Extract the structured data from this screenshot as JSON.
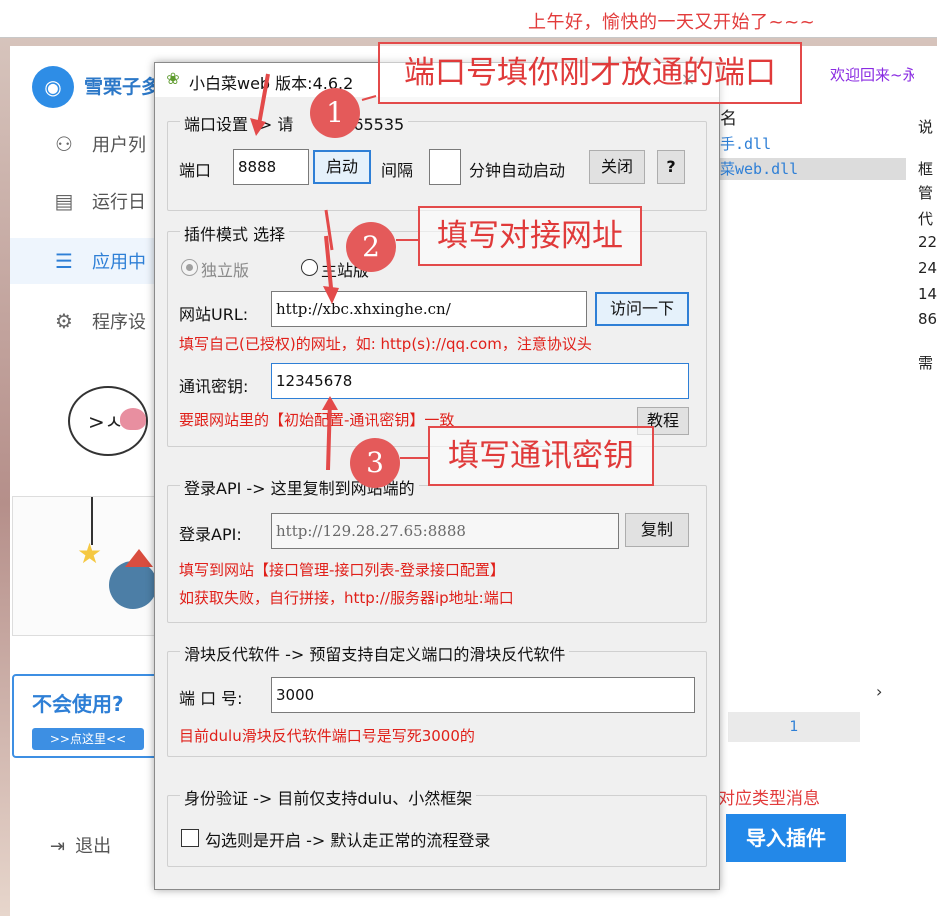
{
  "top_banner": {
    "text": "上午好，愉快的一天又开始了~~~"
  },
  "background_app": {
    "brand": "雪栗子多",
    "welcome": "欢迎回来~永久",
    "nav": [
      {
        "label": "用户列",
        "icon": "user-icon"
      },
      {
        "label": "运行日",
        "icon": "document-icon"
      },
      {
        "label": "应用中",
        "icon": "list-icon"
      },
      {
        "label": "程序设",
        "icon": "gear-icon"
      }
    ],
    "help_card": {
      "title": "不会使用?",
      "button": ">>点这里<<"
    },
    "logout": "退出",
    "plugin_list": {
      "header": "名",
      "items": [
        "手.dll",
        "菜web.dll"
      ]
    },
    "right_column_text": [
      "说",
      "框",
      "管",
      "代",
      "22",
      "24",
      "14",
      "86",
      "需"
    ],
    "page_number": "1",
    "type_message_hint": "对应类型消息",
    "import_button": "导入插件"
  },
  "dialog": {
    "title": "小白菜web  版本:4.6.2",
    "close": "×",
    "port_group": {
      "title": "端口设置 -> 请",
      "range_suffix": "：1-65535",
      "port_label": "端口",
      "port_value": "8888",
      "start_button": "启动",
      "interval_label": "间隔",
      "interval_value": "",
      "auto_start_label": "分钟自动启动",
      "close_button": "关闭",
      "help_button": "?"
    },
    "plugin_mode_group": {
      "title": "插件模式 选择",
      "mode_standalone": "独立版",
      "mode_site": "主站版",
      "url_label": "网站URL:",
      "url_value": "http://xbc.xhxinghe.cn/",
      "visit_button": "访问一下",
      "url_hint": "填写自己(已授权)的网址，如: http(s)://qq.com，注意协议头",
      "key_label": "通讯密钥:",
      "key_value": "12345678",
      "key_hint": "要跟网站里的【初始配置-通讯密钥】一致",
      "tutorial_button": "教程"
    },
    "login_api_group": {
      "title": "登录API -> 这里复制到网站端的",
      "api_label": "登录API:",
      "api_value": "http://129.28.27.65:8888",
      "copy_button": "复制",
      "hint_1": "填写到网站【接口管理-接口列表-登录接口配置】",
      "hint_2": "如获取失败，自行拼接，http://服务器ip地址:端口"
    },
    "slider_group": {
      "title": "滑块反代软件 -> 预留支持自定义端口的滑块反代软件",
      "port_label": "端 口 号:",
      "port_value": "3000",
      "hint": "目前dulu滑块反代软件端口号是写死3000的"
    },
    "auth_group": {
      "title": "身份验证 -> 目前仅支持dulu、小然框架",
      "checkbox_label": "勾选则是开启 -> 默认走正常的流程登录"
    }
  },
  "annotations": {
    "callout_1": "端口号填你刚才放通的端口",
    "callout_2": "填写对接网址",
    "callout_3": "填写通讯密钥",
    "steps": [
      "1",
      "2",
      "3"
    ],
    "accent_color": "#e34a4a"
  }
}
